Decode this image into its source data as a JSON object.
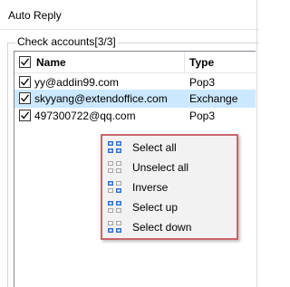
{
  "window": {
    "title": "Auto Reply"
  },
  "accounts": {
    "group_label": "Check accounts[3/3]",
    "header": {
      "name": "Name",
      "type": "Type",
      "checked": true
    },
    "rows": [
      {
        "email": "yy@addin99.com",
        "type": "Pop3",
        "checked": true,
        "selected": false
      },
      {
        "email": "skyyang@extendoffice.com",
        "type": "Exchange",
        "checked": true,
        "selected": true
      },
      {
        "email": "497300722@qq.com",
        "type": "Pop3",
        "checked": true,
        "selected": false
      }
    ]
  },
  "context_menu": {
    "items": [
      {
        "label": "Select all",
        "icon": "select-all-icon"
      },
      {
        "label": "Unselect all",
        "icon": "unselect-all-icon"
      },
      {
        "label": "Inverse",
        "icon": "inverse-icon"
      },
      {
        "label": "Select up",
        "icon": "select-up-icon"
      },
      {
        "label": "Select down",
        "icon": "select-down-icon"
      }
    ]
  },
  "colors": {
    "selection_bg": "#cce8ff",
    "menu_border": "#c9646b",
    "menu_bg": "#f2f2f2",
    "icon_blue": "#2e6fd3",
    "icon_gray": "#a6a6a6"
  }
}
